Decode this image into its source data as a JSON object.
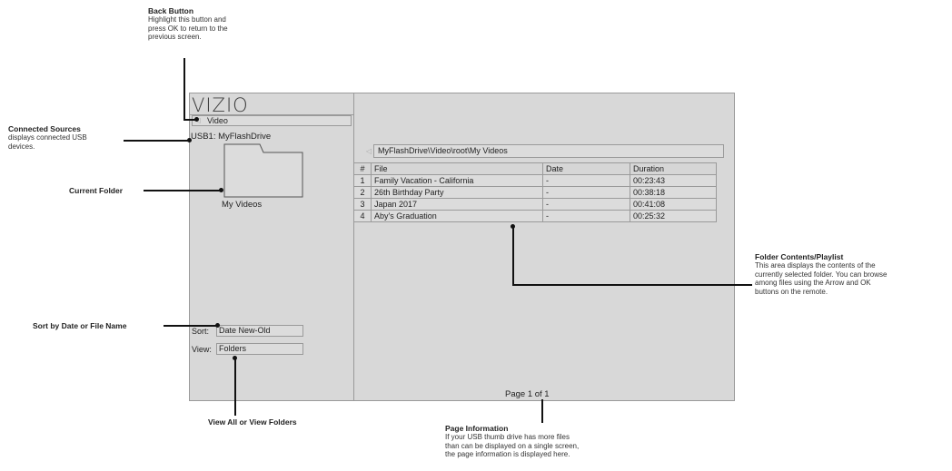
{
  "screen": {
    "logo": "VIZIO",
    "back_label": "Video",
    "back_arrow_icon": "left-triangle",
    "usb_label": "USB1: MyFlashDrive",
    "folder_name": "My Videos",
    "sort_label": "Sort:",
    "sort_value": "Date New-Old",
    "view_label": "View:",
    "view_value": "Folders",
    "path": "MyFlashDrive\\Video\\root\\My Videos",
    "table": {
      "headers": [
        "#",
        "File",
        "Date",
        "Duration"
      ],
      "rows": [
        {
          "num": "1",
          "file": "Family Vacation - California",
          "date": "-",
          "duration": "00:23:43"
        },
        {
          "num": "2",
          "file": "26th Birthday Party",
          "date": "-",
          "duration": "00:38:18"
        },
        {
          "num": "3",
          "file": "Japan 2017",
          "date": "-",
          "duration": "00:41:08"
        },
        {
          "num": "4",
          "file": "Aby's Graduation",
          "date": "-",
          "duration": "00:25:32"
        }
      ]
    },
    "page_info": "Page 1 of 1"
  },
  "annotations": {
    "back_button": {
      "title": "Back Button",
      "lines": [
        "Highlight this button and",
        "press OK to return to the",
        "previous screen."
      ]
    },
    "connected_sources": {
      "title": "Connected Sources",
      "lines": [
        "displays connected USB",
        "devices."
      ]
    },
    "current_folder": {
      "title": "Current Folder"
    },
    "sort": {
      "title": "Sort by Date or File Name"
    },
    "view": {
      "title": "View All or View Folders"
    },
    "folder_contents": {
      "title": "Folder Contents/Playlist",
      "lines": [
        "This area displays the contents of the",
        "currently selected folder. You can browse",
        "among files using the Arrow and OK",
        "buttons on the remote."
      ]
    },
    "page_information": {
      "title": "Page Information",
      "lines": [
        "If your USB thumb drive has more files",
        "than can be displayed on a single screen,",
        "the page information is displayed here."
      ]
    }
  }
}
